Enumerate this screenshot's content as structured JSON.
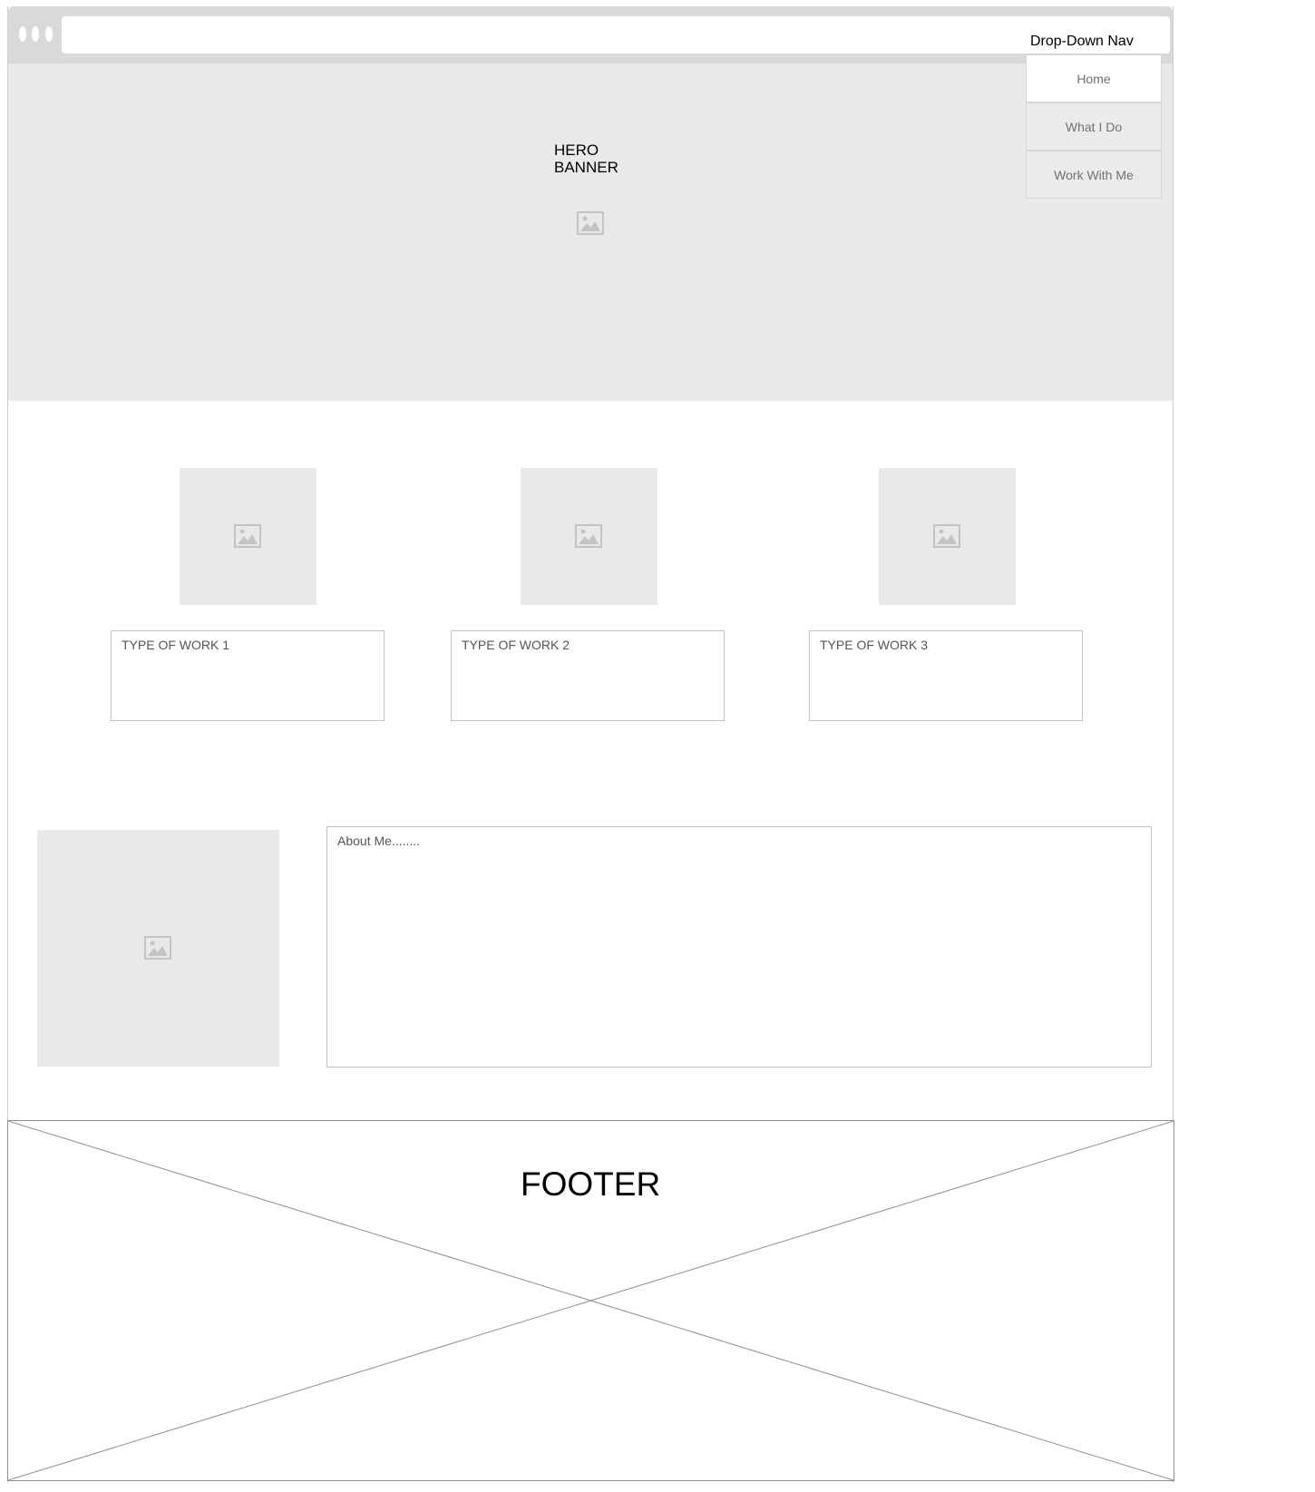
{
  "nav": {
    "title": "Drop-Down Nav",
    "items": [
      {
        "label": "Home"
      },
      {
        "label": "What I Do"
      },
      {
        "label": "Work With Me"
      }
    ]
  },
  "hero": {
    "title": "HERO\nBANNER"
  },
  "work": [
    {
      "label": "TYPE OF WORK 1"
    },
    {
      "label": "TYPE OF WORK 2"
    },
    {
      "label": "TYPE OF WORK 3"
    }
  ],
  "about": {
    "text": "About Me........"
  },
  "footer": {
    "title": "FOOTER"
  },
  "colors": {
    "placeholder": "#e9e9e9",
    "chrome": "#d9d9d9",
    "border": "#c4c4c4"
  },
  "icons": {
    "image": "image-placeholder-icon",
    "window_dots": "window-dots-icon"
  }
}
